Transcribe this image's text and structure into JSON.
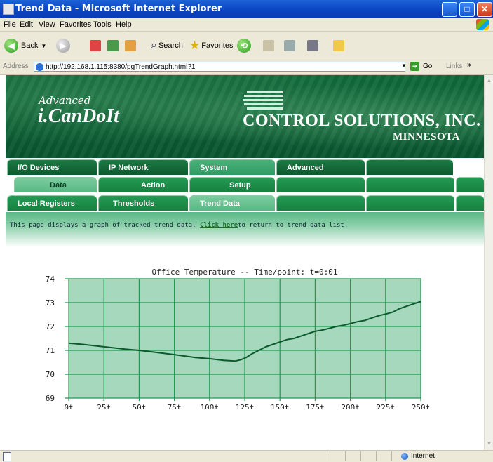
{
  "window": {
    "title": "Trend Data - Microsoft Internet Explorer"
  },
  "menu": [
    "File",
    "Edit",
    "View",
    "Favorites",
    "Tools",
    "Help"
  ],
  "toolbar": {
    "back": "Back",
    "search": "Search",
    "favorites": "Favorites"
  },
  "address": {
    "label": "Address",
    "url": "http://192.168.1.115:8380/pgTrendGraph.html?1",
    "go": "Go",
    "links": "Links"
  },
  "banner": {
    "advanced": "Advanced",
    "brand": "i.CanDoIt",
    "company": "CONTROL SOLUTIONS, INC.",
    "state": "MINNESOTA"
  },
  "tabs_row1": [
    "I/O Devices",
    "IP Network",
    "System",
    "Advanced",
    ""
  ],
  "tabs_row2": [
    "Data",
    "Action Rules",
    "Setup",
    "",
    ""
  ],
  "tabs_row3": [
    "Local Registers",
    "Thresholds",
    "Trend Data",
    "",
    ""
  ],
  "info": {
    "text_before": "This page displays a graph of tracked trend data. ",
    "link": "Click here",
    "text_after": "to return to trend data list."
  },
  "status": {
    "zone": "Internet"
  },
  "colors": {
    "banner": "#0f6b3b",
    "plot_fill": "#a5d8bd",
    "grid": "#1f9a50",
    "line": "#0b5a2c"
  },
  "chart_data": {
    "type": "line",
    "title": "Office Temperature -- Time/point: t=0:01",
    "xlabel": "",
    "ylabel": "",
    "xlim": [
      0,
      250
    ],
    "ylim": [
      69,
      74
    ],
    "x_ticks": [
      "0t",
      "25t",
      "50t",
      "75t",
      "100t",
      "125t",
      "150t",
      "175t",
      "200t",
      "225t",
      "250t"
    ],
    "y_ticks": [
      "74",
      "73",
      "72",
      "71",
      "70",
      "69"
    ],
    "grid": true,
    "x": [
      0,
      10,
      25,
      40,
      50,
      60,
      75,
      90,
      100,
      110,
      118,
      122,
      126,
      130,
      135,
      140,
      145,
      150,
      155,
      160,
      165,
      170,
      175,
      180,
      185,
      190,
      195,
      200,
      205,
      210,
      215,
      220,
      225,
      230,
      235,
      240,
      245,
      250
    ],
    "y": [
      71.3,
      71.25,
      71.15,
      71.05,
      71.0,
      70.93,
      70.82,
      70.7,
      70.65,
      70.58,
      70.55,
      70.6,
      70.7,
      70.85,
      71.0,
      71.15,
      71.25,
      71.35,
      71.45,
      71.5,
      71.6,
      71.7,
      71.8,
      71.85,
      71.92,
      72.0,
      72.05,
      72.12,
      72.2,
      72.25,
      72.35,
      72.45,
      72.52,
      72.6,
      72.75,
      72.85,
      72.95,
      73.05
    ]
  }
}
